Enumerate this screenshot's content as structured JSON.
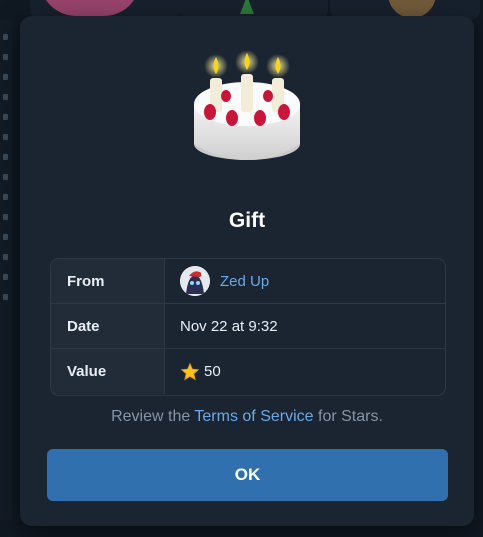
{
  "dialog": {
    "title": "Gift",
    "rows": [
      {
        "label": "From",
        "value": "Zed Up"
      },
      {
        "label": "Date",
        "value": "Nov 22 at 9:32"
      },
      {
        "label": "Value",
        "value": "50"
      }
    ],
    "terms_prefix": "Review the",
    "terms_link": "Terms of Service",
    "terms_suffix": "for Stars.",
    "ok_label": "OK",
    "gift_icon": "birthday-cake-icon",
    "value_icon": "star-icon"
  },
  "colors": {
    "modal_bg": "#1b2431",
    "accent": "#3070ae",
    "link": "#6aa9ea"
  }
}
